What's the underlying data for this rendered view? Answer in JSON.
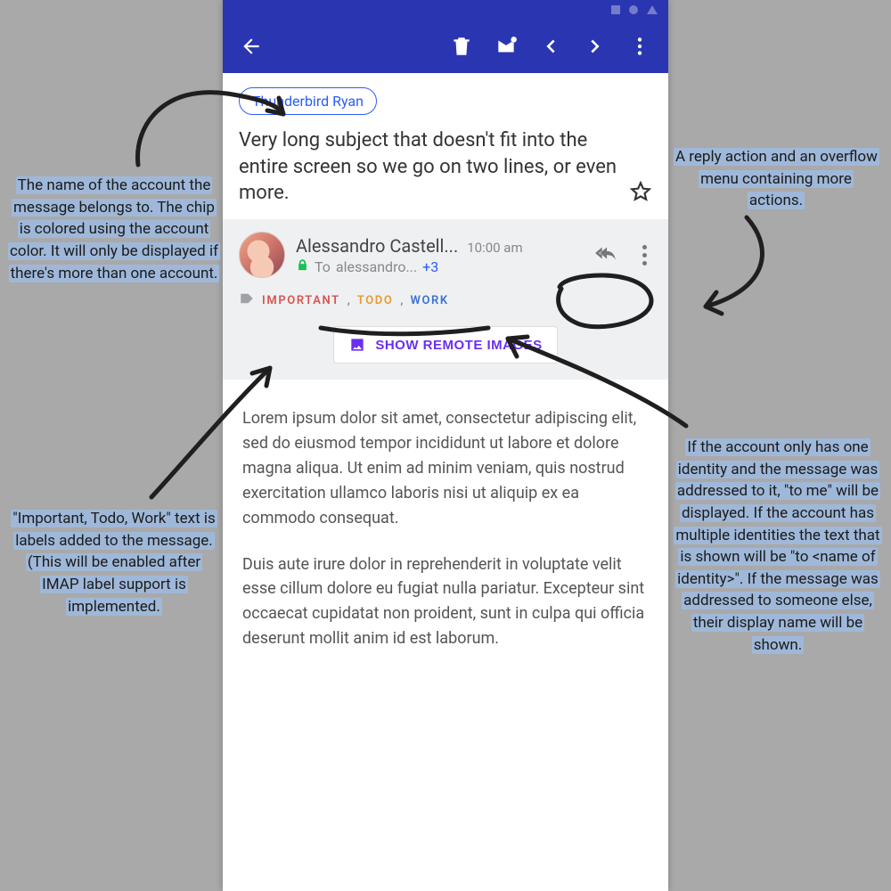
{
  "account": {
    "chip_label": "Thunderbird Ryan"
  },
  "subject": "Very long subject that doesn't fit into the entire screen so we go on two lines, or even more.",
  "header": {
    "sender": "Alessandro Castell...",
    "time": "10:00 am",
    "to_prefix": "To ",
    "to_name": "alessandro...",
    "more_recipients": "+3"
  },
  "labels": {
    "important": "IMPORTANT",
    "todo": "TODO",
    "work": "WORK"
  },
  "remote_button": "SHOW REMOTE IMAGES",
  "body": {
    "p1": "Lorem ipsum dolor sit amet, consectetur adipiscing elit, sed do eiusmod tempor incididunt ut labore et dolore magna aliqua. Ut enim ad minim veniam, quis nostrud exercitation ullamco laboris nisi ut aliquip ex ea commodo consequat.",
    "p2": "Duis aute irure dolor in reprehenderit in voluptate velit esse cillum dolore eu fugiat nulla pariatur. Excepteur sint occaecat cupidatat non proident, sunt in culpa qui officia deserunt mollit anim id est laborum."
  },
  "annotations": {
    "account_chip": "The name of the account the message belongs to.\nThe chip is colored using the account color.\nIt will only be displayed if there's more than one account.",
    "labels": "\"Important, Todo, Work\" text is labels added to the message. (This will be enabled after IMAP label support is implemented.",
    "actions": "A reply action and an overflow menu containing more actions.",
    "to_line": "If the account only has one identity and the message was addressed to it, \"to me\" will be displayed.\nIf the account has multiple identities the text that is shown will be \"to <name of identity>\".\nIf the message was addressed to someone else, their display name will be shown."
  }
}
